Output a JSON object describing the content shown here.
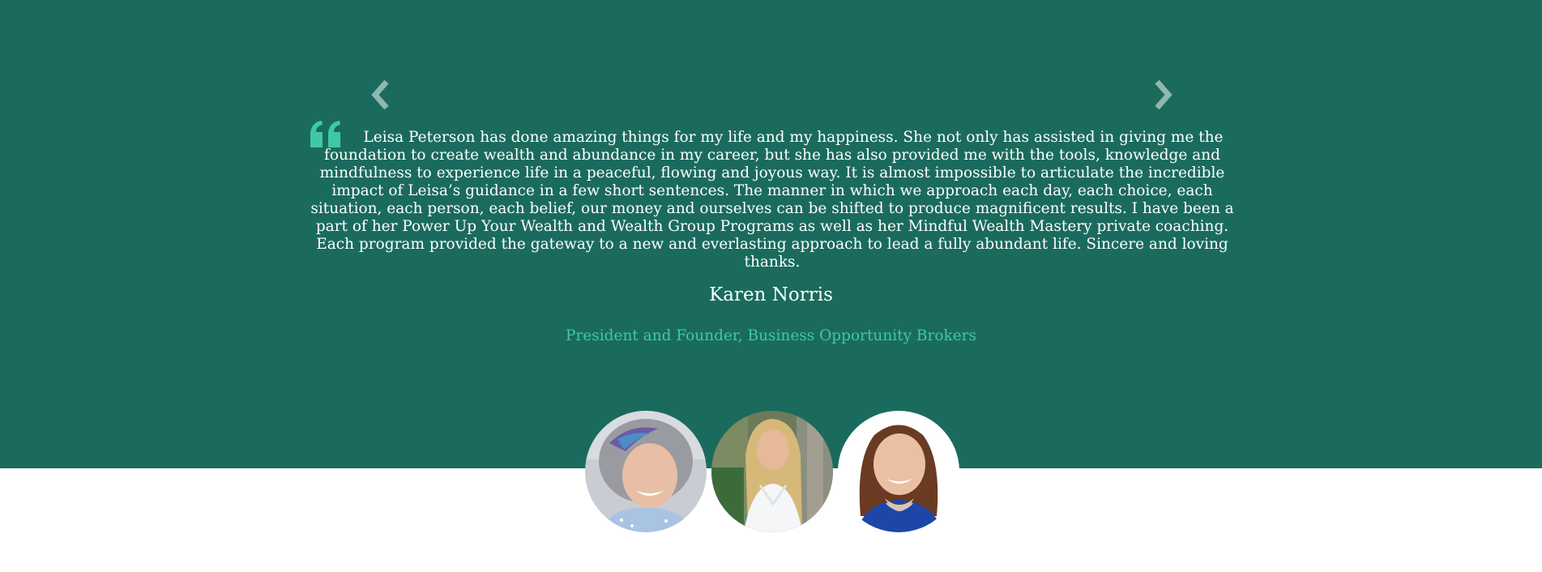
{
  "testimonial": {
    "quote": "Leisa Peterson has done amazing things for my life and my happiness. She not only has assisted in giving me the foundation to create wealth and abundance in my career, but she has also provided me with the tools, knowledge and mindfulness to experience life in a peaceful, flowing and joyous way. It is almost impossible to articulate the incredible impact of Leisa’s guidance in a few short sentences. The manner in which we approach each day, each choice, each situation, each person, each belief, our money and ourselves can be shifted to produce magnificent results. I have been a part of her Power Up Your Wealth and Wealth Group Programs as well as her Mindful Wealth Mastery private coaching. Each program provided the gateway to a new and everlasting approach to lead a fully abundant life. Sincere and loving thanks.",
    "author_name": "Karen Norris",
    "author_title": "President and Founder, Business Opportunity Brokers"
  },
  "icons": {
    "prev": "chevron-left-icon",
    "next": "chevron-right-icon",
    "quote": "quote-icon"
  },
  "colors": {
    "background": "#1a6b5d",
    "accent": "#3fc9a3",
    "text": "#ffffff",
    "arrow": "#8fb8ae"
  }
}
